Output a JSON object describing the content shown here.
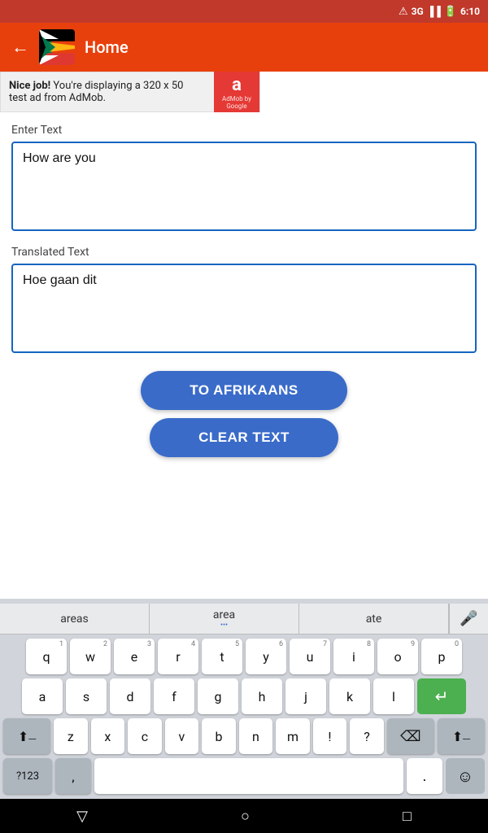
{
  "statusBar": {
    "signal": "3G",
    "time": "6:10",
    "batteryLevel": 80
  },
  "appBar": {
    "title": "Home",
    "backLabel": "←"
  },
  "ad": {
    "line1": "Nice job!",
    "line2": " You're displaying a 320 x 50",
    "line3": "test ad from AdMob.",
    "logoText": "a",
    "poweredBy": "AdMob by Google"
  },
  "enterTextLabel": "Enter Text",
  "inputText": "How are you",
  "translatedTextLabel": "Translated Text",
  "translatedText": "Hoe gaan dit",
  "buttons": {
    "toAfrikaans": "TO AFRIKAANS",
    "clearText": "CLEAR TEXT"
  },
  "keyboard": {
    "suggestions": [
      "areas",
      "area",
      "ate"
    ],
    "rows": [
      [
        "q",
        "w",
        "e",
        "r",
        "t",
        "y",
        "u",
        "i",
        "o",
        "p"
      ],
      [
        "a",
        "s",
        "d",
        "f",
        "g",
        "h",
        "j",
        "k",
        "l"
      ],
      [
        "z",
        "x",
        "c",
        "v",
        "b",
        "n",
        "m"
      ]
    ],
    "numbers": [
      "1",
      "2",
      "3",
      "4",
      "5",
      "6",
      "7",
      "8",
      "9",
      "0"
    ],
    "symLabel": "?123",
    "commaLabel": ",",
    "periodLabel": "."
  },
  "navBar": {
    "backIcon": "▽",
    "homeIcon": "○",
    "recentIcon": "□"
  },
  "colors": {
    "appBarBg": "#e8400c",
    "buttonBg": "#3a6bc9",
    "inputBorder": "#1565c0",
    "returnKey": "#4caf50"
  }
}
